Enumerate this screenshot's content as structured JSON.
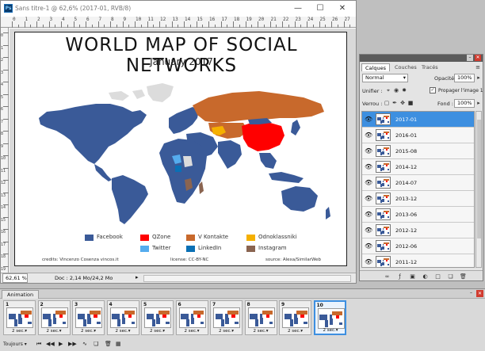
{
  "document": {
    "title": "Sans titre-1 @ 62,6% (2017-01, RVB/8)",
    "app_icon": "photoshop-icon",
    "ruler_h": [
      "0",
      "1",
      "2",
      "3",
      "4",
      "5",
      "6",
      "7",
      "8",
      "9",
      "10",
      "11",
      "12",
      "13",
      "14",
      "15",
      "16",
      "17",
      "18",
      "19",
      "20",
      "21",
      "22",
      "23",
      "24",
      "25",
      "26",
      "27",
      "28"
    ],
    "ruler_v": [
      "0",
      "1",
      "2",
      "3",
      "4",
      "5",
      "6",
      "7",
      "8",
      "9",
      "10",
      "11",
      "12",
      "13",
      "14",
      "15",
      "16",
      "17",
      "18",
      "19",
      "20"
    ],
    "zoom": "62,61 %",
    "doc_info": "Doc : 2,14 Mo/24,2 Mo"
  },
  "map": {
    "title": "WORLD MAP OF SOCIAL NETWORKS",
    "subtitle": "January 2017",
    "legend": [
      {
        "label": "Facebook",
        "color": "#3a5a98"
      },
      {
        "label": "QZone",
        "color": "#ff0000"
      },
      {
        "label": "V Kontakte",
        "color": "#c8692c"
      },
      {
        "label": "Odnoklassniki",
        "color": "#f5b000"
      },
      {
        "label": "Twitter",
        "color": "#55acee"
      },
      {
        "label": "LinkedIn",
        "color": "#0a70b5"
      },
      {
        "label": "Instagram",
        "color": "#8a6450"
      }
    ],
    "credit_author": "credits: Vincenzo Cosenza vincos.it",
    "credit_license": "license: CC-BY-NC",
    "credit_source": "source: Alexa/SimilarWeb",
    "colors": {
      "land": "#3a5a98",
      "ocean": "#ffffff",
      "nodata": "#dcdcdc"
    }
  },
  "layers_panel": {
    "tabs": [
      "Calques",
      "Couches",
      "Tracés"
    ],
    "blend_mode": "Normal",
    "opacity_label": "Opacité :",
    "opacity_value": "100%",
    "unify_label": "Unifier :",
    "propagate_label": "Propager l'image 1",
    "propagate_checked": true,
    "lock_label": "Verrou :",
    "fill_label": "Fond :",
    "fill_value": "100%",
    "layers": [
      {
        "name": "2017-01",
        "visible": true,
        "active": true
      },
      {
        "name": "2016-01",
        "visible": true,
        "active": false
      },
      {
        "name": "2015-08",
        "visible": true,
        "active": false
      },
      {
        "name": "2014-12",
        "visible": true,
        "active": false
      },
      {
        "name": "2014-07",
        "visible": true,
        "active": false
      },
      {
        "name": "2013-12",
        "visible": true,
        "active": false
      },
      {
        "name": "2013-06",
        "visible": true,
        "active": false
      },
      {
        "name": "2012-12",
        "visible": true,
        "active": false
      },
      {
        "name": "2012-06",
        "visible": true,
        "active": false
      },
      {
        "name": "2011-12",
        "visible": true,
        "active": false
      }
    ],
    "footer_icons": [
      "link-icon",
      "fx-icon",
      "mask-icon",
      "adjustment-icon",
      "group-icon",
      "new-layer-icon",
      "trash-icon"
    ]
  },
  "animation_panel": {
    "tab": "Animation",
    "frames": [
      {
        "num": "1",
        "delay": "2 sec."
      },
      {
        "num": "2",
        "delay": "2 sec."
      },
      {
        "num": "3",
        "delay": "2 sec."
      },
      {
        "num": "4",
        "delay": "2 sec."
      },
      {
        "num": "5",
        "delay": "2 sec."
      },
      {
        "num": "6",
        "delay": "2 sec."
      },
      {
        "num": "7",
        "delay": "2 sec."
      },
      {
        "num": "8",
        "delay": "2 sec."
      },
      {
        "num": "9",
        "delay": "2 sec."
      },
      {
        "num": "10",
        "delay": "2 sec."
      }
    ],
    "active_frame": 10,
    "loop": "Toujours"
  }
}
